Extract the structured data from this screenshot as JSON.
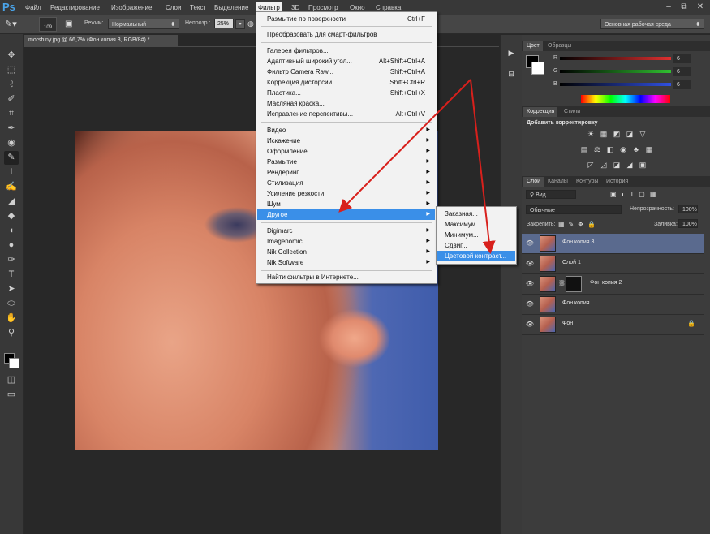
{
  "app": {
    "logo": "Ps"
  },
  "menubar": {
    "items": [
      "Файл",
      "Редактирование",
      "Изображение",
      "Слои",
      "Текст",
      "Выделение",
      "Фильтр",
      "3D",
      "Просмотр",
      "Окно",
      "Справка"
    ],
    "active": "Фильтр",
    "window_controls": [
      "–",
      "⧉",
      "✕"
    ]
  },
  "options_bar": {
    "brush_size": "109",
    "mode_label": "Режим:",
    "mode_value": "Нормальный",
    "opacity_label": "Непрозр.:",
    "opacity_value": "25%",
    "workspace": "Основная рабочая среда"
  },
  "document": {
    "tab": "morshiny.jpg @ 66,7% (Фон копия 3, RGB/8#) *"
  },
  "filter_menu": {
    "items": [
      {
        "label": "Размытие по поверхности",
        "shortcut": "Ctrl+F"
      },
      {
        "label": "Преобразовать для смарт-фильтров",
        "shortcut": ""
      },
      {
        "label": "Галерея фильтров...",
        "shortcut": ""
      },
      {
        "label": "Адаптивный широкий угол...",
        "shortcut": "Alt+Shift+Ctrl+A"
      },
      {
        "label": "Фильтр Camera Raw...",
        "shortcut": "Shift+Ctrl+A"
      },
      {
        "label": "Коррекция дисторсии...",
        "shortcut": "Shift+Ctrl+R"
      },
      {
        "label": "Пластика...",
        "shortcut": "Shift+Ctrl+X"
      },
      {
        "label": "Масляная краска...",
        "shortcut": ""
      },
      {
        "label": "Исправление перспективы...",
        "shortcut": "Alt+Ctrl+V"
      },
      {
        "label": "Видео",
        "shortcut": ""
      },
      {
        "label": "Искажение",
        "shortcut": ""
      },
      {
        "label": "Оформление",
        "shortcut": ""
      },
      {
        "label": "Размытие",
        "shortcut": ""
      },
      {
        "label": "Рендеринг",
        "shortcut": ""
      },
      {
        "label": "Стилизация",
        "shortcut": ""
      },
      {
        "label": "Усиление резкости",
        "shortcut": ""
      },
      {
        "label": "Шум",
        "shortcut": ""
      },
      {
        "label": "Другое",
        "shortcut": ""
      },
      {
        "label": "Digimarc",
        "shortcut": ""
      },
      {
        "label": "Imagenomic",
        "shortcut": ""
      },
      {
        "label": "Nik Collection",
        "shortcut": ""
      },
      {
        "label": "Nik Software",
        "shortcut": ""
      },
      {
        "label": "Найти фильтры в Интернете...",
        "shortcut": ""
      }
    ],
    "submenu_arrow": "▶"
  },
  "other_submenu": {
    "items": [
      "Заказная...",
      "Максимум...",
      "Минимум...",
      "Сдвиг...",
      "Цветовой контраст..."
    ],
    "highlighted": "Цветовой контраст..."
  },
  "color_panel": {
    "tabs": [
      "Цвет",
      "Образцы"
    ],
    "channels": [
      {
        "label": "R",
        "value": "6",
        "color": "#e03030"
      },
      {
        "label": "G",
        "value": "6",
        "color": "#30c030"
      },
      {
        "label": "B",
        "value": "6",
        "color": "#3050e0"
      }
    ]
  },
  "adjustments_panel": {
    "tabs": [
      "Коррекция",
      "Стили"
    ],
    "title": "Добавить корректировку",
    "icons_row1": [
      "☀",
      "▦",
      "◩",
      "◪",
      "▽"
    ],
    "icons_row2": [
      "▤",
      "⚖",
      "◧",
      "◉",
      "♣",
      "▦"
    ],
    "icons_row3": [
      "◸",
      "◿",
      "◪",
      "◢",
      "▣"
    ]
  },
  "layers_panel": {
    "tabs": [
      "Слои",
      "Каналы",
      "Контуры",
      "История"
    ],
    "filter_label": "Вид",
    "blend_mode": "Обычные",
    "opacity_label": "Непрозрачность:",
    "opacity_value": "100%",
    "lock_label": "Закрепить:",
    "fill_label": "Заливка:",
    "fill_value": "100%",
    "layers": [
      {
        "name": "Фон копия 3",
        "selected": true
      },
      {
        "name": "Слой 1",
        "selected": false
      },
      {
        "name": "Фон копия 2",
        "selected": false
      },
      {
        "name": "Фон копия",
        "selected": false
      },
      {
        "name": "Фон",
        "selected": false
      }
    ]
  },
  "accent_colors": {
    "highlight": "#3a8fe8",
    "arrow": "#d8201c",
    "selected_layer": "#5a6a8e"
  }
}
